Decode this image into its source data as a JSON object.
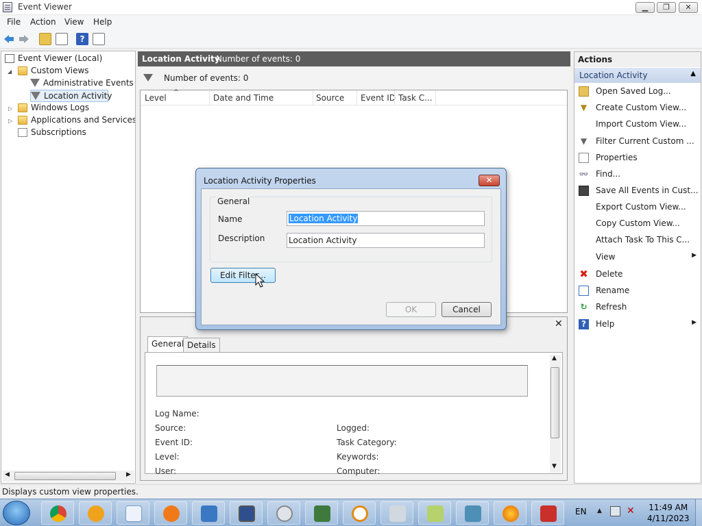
{
  "window": {
    "title": "Event Viewer"
  },
  "menu": [
    "File",
    "Action",
    "View",
    "Help"
  ],
  "tree": {
    "root": "Event Viewer (Local)",
    "custom_views": "Custom Views",
    "admin_events": "Administrative Events",
    "location_activity": "Location Activity",
    "windows_logs": "Windows Logs",
    "app_services": "Applications and Services Lo",
    "subscriptions": "Subscriptions"
  },
  "center": {
    "title": "Location Activity",
    "count": "Number of events: 0",
    "filter_text": "Number of events: 0",
    "columns": [
      "Level",
      "Date and Time",
      "Source",
      "Event ID",
      "Task C..."
    ]
  },
  "detail": {
    "tabs": [
      "General",
      "Details"
    ],
    "fields_left": [
      "Log Name:",
      "Source:",
      "Event ID:",
      "Level:",
      "User:"
    ],
    "fields_right": [
      "Logged:",
      "Task Category:",
      "Keywords:",
      "Computer:"
    ]
  },
  "actions": {
    "title": "Actions",
    "section": "Location Activity",
    "items": [
      "Open Saved Log...",
      "Create Custom View...",
      "Import Custom View...",
      "Filter Current Custom ...",
      "Properties",
      "Find...",
      "Save All Events in Cust...",
      "Export Custom View...",
      "Copy Custom View...",
      "Attach Task To This C...",
      "View",
      "Delete",
      "Rename",
      "Refresh",
      "Help"
    ]
  },
  "status": "Displays custom view properties.",
  "dialog": {
    "title": "Location Activity Properties",
    "close": "✕",
    "group_label": "General",
    "name_label": "Name",
    "name_value": "Location Activity",
    "description_label": "Description",
    "description_value": "Location Activity",
    "edit_filter": "Edit Filter...",
    "ok": "OK",
    "cancel": "Cancel"
  },
  "taskbar": {
    "lang": "EN",
    "time": "11:49 AM",
    "date": "4/11/2023"
  }
}
